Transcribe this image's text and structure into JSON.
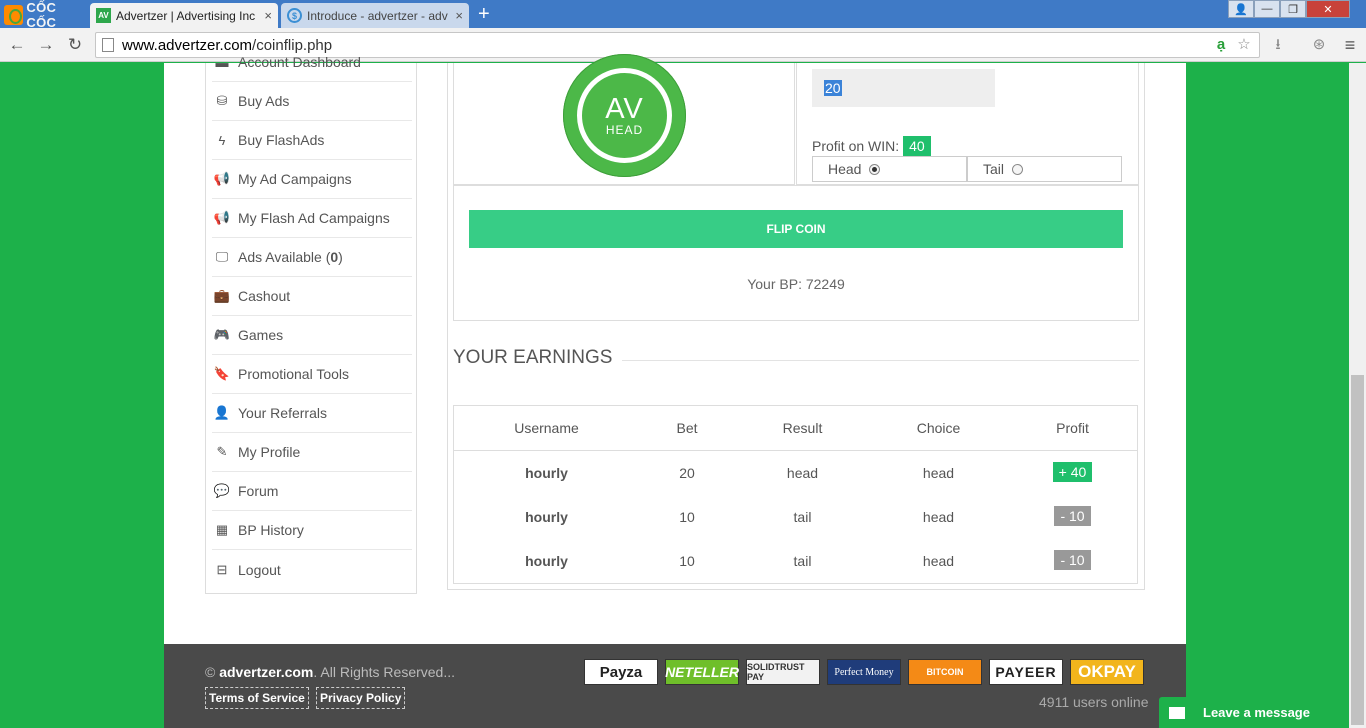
{
  "browser": {
    "brand": "CỐC CỐC",
    "tabs": [
      {
        "favicon": "AV",
        "title": "Advertzer | Advertising Inc",
        "close": "×"
      },
      {
        "favicon": "$",
        "title": "Introduce - advertzer - adv",
        "close": "×"
      }
    ],
    "new_tab": "+",
    "window_controls": {
      "user": "👤",
      "minimize": "—",
      "maximize": "❐",
      "close": "✕"
    },
    "nav": {
      "back": "←",
      "forward": "→",
      "reload": "↻"
    },
    "url_domain": "www.advertzer.com",
    "url_path": "/coinflip.php",
    "toolbar_icons": {
      "translate": "ạ",
      "star": "☆",
      "download": "⭳",
      "extension": "⊛",
      "menu": "≡"
    }
  },
  "sidebar": {
    "items": [
      {
        "icon": "dashboard-icon",
        "glyph": "▬",
        "label": "Account Dashboard"
      },
      {
        "icon": "coins-icon",
        "glyph": "⛁",
        "label": "Buy Ads"
      },
      {
        "icon": "bolt-icon",
        "glyph": "ϟ",
        "label": "Buy FlashAds"
      },
      {
        "icon": "megaphone-icon",
        "glyph": "📢",
        "label": "My Ad Campaigns"
      },
      {
        "icon": "megaphone-icon",
        "glyph": "📢",
        "label": "My Flash Ad Campaigns"
      },
      {
        "icon": "monitor-icon",
        "glyph": "🖵",
        "label": "Ads Available (",
        "count": "0",
        "suffix": ")"
      },
      {
        "icon": "briefcase-icon",
        "glyph": "💼",
        "label": "Cashout"
      },
      {
        "icon": "gamepad-icon",
        "glyph": "🎮",
        "label": "Games"
      },
      {
        "icon": "bookmark-icon",
        "glyph": "🔖",
        "label": "Promotional Tools"
      },
      {
        "icon": "user-icon",
        "glyph": "👤",
        "label": "Your Referrals"
      },
      {
        "icon": "edit-icon",
        "glyph": "✎",
        "label": "My Profile"
      },
      {
        "icon": "comments-icon",
        "glyph": "💬",
        "label": "Forum"
      },
      {
        "icon": "calendar-icon",
        "glyph": "▦",
        "label": "BP History"
      },
      {
        "icon": "logout-icon",
        "glyph": "⊟",
        "label": "Logout"
      }
    ]
  },
  "coinflip": {
    "coin_text": "AV",
    "coin_side": "HEAD",
    "bet_value": "20",
    "profit_label": "Profit on WIN:",
    "profit_value": "40",
    "options": [
      {
        "label": "Head",
        "selected": true
      },
      {
        "label": "Tail",
        "selected": false
      }
    ],
    "flip_button": "FLIP COIN",
    "balance_label": "Your BP: 72249"
  },
  "earnings": {
    "title": "YOUR EARNINGS",
    "columns": [
      "Username",
      "Bet",
      "Result",
      "Choice",
      "Profit"
    ],
    "rows": [
      {
        "username": "hourly",
        "bet": "20",
        "result": "head",
        "choice": "head",
        "profit": "+ 40",
        "win": true
      },
      {
        "username": "hourly",
        "bet": "10",
        "result": "tail",
        "choice": "head",
        "profit": "- 10",
        "win": false
      },
      {
        "username": "hourly",
        "bet": "10",
        "result": "tail",
        "choice": "head",
        "profit": "- 10",
        "win": false
      }
    ]
  },
  "footer": {
    "copyright_symbol": "©",
    "site": "advertzer.com",
    "rights": ". All Rights Reserved...",
    "links": [
      "Terms of Service",
      "Privacy Policy"
    ],
    "payments": [
      "Payza",
      "NETELLER",
      "SOLIDTRUST PAY",
      "Perfect Money",
      "BITCOIN",
      "PAYEER",
      "OKPAY"
    ],
    "online": "4911 users online"
  },
  "chat": {
    "label": "Leave a message"
  },
  "colors": {
    "accent_green": "#37cd86",
    "page_bg": "#1db14a",
    "loss_gray": "#999999",
    "win_green": "#1fbf6c"
  }
}
